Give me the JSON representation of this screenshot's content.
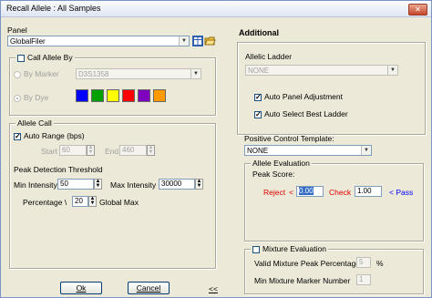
{
  "window": {
    "title": "Recall Allele : All Samples",
    "close_glyph": "✕"
  },
  "panel": {
    "label": "Panel",
    "selected": "GlobalFiler",
    "arrow": "▼",
    "icon_names": [
      "table-icon",
      "open-folder-icon"
    ]
  },
  "call_allele_by": {
    "label": "Call Allele By",
    "checked": false,
    "by_marker": {
      "label": "By Marker",
      "selected": "D3S1358"
    },
    "by_dye": {
      "label": "By Dye",
      "selected": true
    },
    "dye_colors": [
      "#0000ff",
      "#00a000",
      "#ffff00",
      "#ff0000",
      "#8000c0",
      "#ff9900"
    ]
  },
  "allele_call": {
    "label": "Allele Call",
    "auto_range": {
      "label": "Auto Range (bps)",
      "checked": true
    },
    "start": {
      "label": "Start",
      "value": "60"
    },
    "end": {
      "label": "End",
      "value": "460"
    },
    "peak_threshold_label": "Peak Detection Threshold",
    "min_intensity": {
      "label": "Min Intensity",
      "value": "50"
    },
    "max_intensity": {
      "label": "Max Intensity",
      "value": "30000"
    },
    "percentage": {
      "label": "Percentage \\ ",
      "value": "20",
      "suffix": "Global Max"
    }
  },
  "additional": {
    "title": "Additional",
    "allelic_ladder": {
      "label": "Allelic Ladder",
      "selected": "NONE"
    },
    "auto_panel_adjustment": {
      "label": "Auto Panel Adjustment",
      "checked": true
    },
    "auto_select_best_ladder": {
      "label": "Auto Select Best Ladder",
      "checked": true
    },
    "positive_control": {
      "label": "Positive Control Template:",
      "selected": "NONE"
    },
    "allele_evaluation": {
      "label": "Allele Evaluation",
      "peak_score_label": "Peak Score:",
      "reject_label": "Reject",
      "reject_lt": "<",
      "reject_value": "0.00",
      "check_label": "Check",
      "check_value": "1.00",
      "pass_label": "< Pass"
    },
    "mixture": {
      "label": "Mixture Evaluation",
      "checked": false,
      "valid_peak_pct": {
        "label": "Valid Mixture Peak Percentage",
        "value": "5",
        "suffix": "%"
      },
      "min_marker": {
        "label": "Min Mixture Marker Number",
        "value": "1"
      }
    }
  },
  "buttons": {
    "ok": "Ok",
    "cancel": "Cancel",
    "collapse": "<<"
  }
}
